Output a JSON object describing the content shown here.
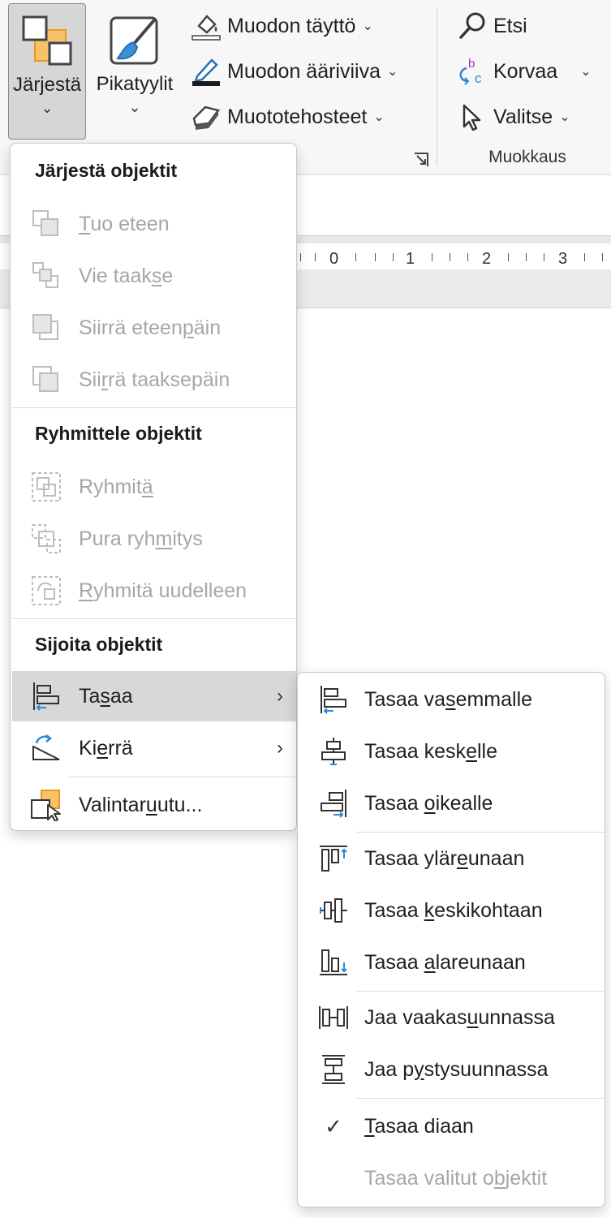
{
  "ribbon": {
    "jarjesta": {
      "label": "Järjestä",
      "chevron": "⌄"
    },
    "pikatyylit": {
      "label": "Pikatyylit",
      "chevron": "⌄"
    },
    "shape_fill": {
      "label": "Muodon täyttö",
      "dropdown": "⌄"
    },
    "shape_outline": {
      "label": "Muodon ääriviiva",
      "dropdown": "⌄"
    },
    "shape_effects": {
      "label": "Muototehosteet",
      "dropdown": "⌄"
    },
    "find": {
      "label": "Etsi"
    },
    "replace": {
      "label": "Korvaa",
      "dropdown": "⌄"
    },
    "select": {
      "label": "Valitse",
      "dropdown": "⌄"
    },
    "editing_group_label": "Muokkaus"
  },
  "ruler": {
    "ticks": [
      "0",
      "1",
      "2",
      "3"
    ]
  },
  "arrange_menu": {
    "section_order": "Järjestä objektit",
    "bring_forward": {
      "pre": "",
      "key": "T",
      "post": "uo eteen"
    },
    "send_backward": {
      "pre": "Vie taak",
      "key": "s",
      "post": "e"
    },
    "move_forward": {
      "pre": "Siirrä eteen",
      "key": "p",
      "post": "äin"
    },
    "move_backward": {
      "pre": "Sii",
      "key": "r",
      "post": "rä taaksepäin"
    },
    "section_group": "Ryhmittele objektit",
    "group": {
      "pre": "Ryhmit",
      "key": "ä",
      "post": ""
    },
    "ungroup": {
      "pre": "Pura ryh",
      "key": "m",
      "post": "itys"
    },
    "regroup": {
      "pre": "",
      "key": "R",
      "post": "yhmitä uudelleen"
    },
    "section_position": "Sijoita objektit",
    "align": {
      "pre": "Ta",
      "key": "s",
      "post": "aa",
      "arrow": "›"
    },
    "rotate": {
      "pre": "Ki",
      "key": "e",
      "post": "rrä",
      "arrow": "›"
    },
    "selection_pane": {
      "pre": "Valintar",
      "key": "u",
      "post": "utu..."
    }
  },
  "align_submenu": {
    "left": {
      "pre": "Tasaa va",
      "key": "s",
      "post": "emmalle"
    },
    "center": {
      "pre": "Tasaa kesk",
      "key": "e",
      "post": "lle"
    },
    "right": {
      "pre": "Tasaa ",
      "key": "o",
      "post": "ikealle"
    },
    "top": {
      "pre": "Tasaa ylär",
      "key": "e",
      "post": "unaan"
    },
    "middle": {
      "pre": "Tasaa ",
      "key": "k",
      "post": "eskikohtaan"
    },
    "bottom": {
      "pre": "Tasaa ",
      "key": "a",
      "post": "lareunaan"
    },
    "distribute_h": {
      "pre": "Jaa vaakas",
      "key": "u",
      "post": "unnassa"
    },
    "distribute_v": {
      "pre": "Jaa p",
      "key": "y",
      "post": "stysuunnassa"
    },
    "to_slide": {
      "pre": "",
      "key": "T",
      "post": "asaa diaan",
      "check": "✓"
    },
    "selected": {
      "pre": "Tasaa valitut o",
      "key": "b",
      "post": "jektit"
    }
  },
  "colors": {
    "accent_orange": "#f3a83b",
    "accent_blue": "#2b88d8",
    "disabled_text": "#a6a6a6"
  }
}
